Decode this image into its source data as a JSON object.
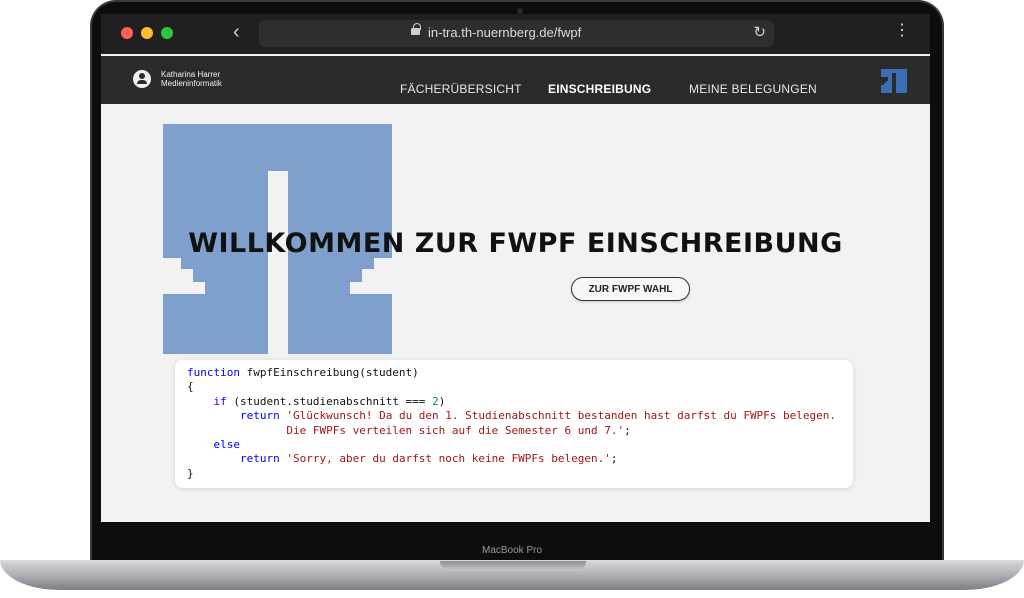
{
  "device": {
    "model_label": "MacBook Pro"
  },
  "browser": {
    "url": "in-tra.th-nuernberg.de/fwpf",
    "back_icon": "‹",
    "forward_icon": "›",
    "reload_icon": "↻",
    "menu_icon": "⋮"
  },
  "header": {
    "user_name": "Katharina Harrer",
    "user_department": "Medieninformatik",
    "nav": [
      {
        "label": "FÄCHERÜBERSICHT"
      },
      {
        "label": "EINSCHREIBUNG"
      },
      {
        "label": "MEINE BELEGUNGEN"
      }
    ],
    "logo_color": "#3a6fb5"
  },
  "main": {
    "title": "WILLKOMMEN ZUR FWPF EINSCHREIBUNG",
    "cta_label": "ZUR FWPF WAHL",
    "logo_color": "#7fa0cc"
  },
  "code": {
    "line1_kw": "function",
    "line1_rest": " fwpfEinschreibung(student)",
    "line2": "{",
    "line3_kw": "if",
    "line3_rest": " (student.studienabschnitt === ",
    "line3_num": "2",
    "line3_end": ")",
    "line4_kw": "return",
    "line4_str": "'Glückwunsch! Da du den 1. Studienabschnitt bestanden hast darfst du FWPFs belegen.",
    "line5_str": "Die FWPFs verteilen sich auf die Semester 6 und 7.'",
    "line5_end": ";",
    "line6_kw": "else",
    "line7_kw": "return",
    "line7_str": "'Sorry, aber du darfst noch keine FWPFs belegen.'",
    "line7_end": ";",
    "line8": "}"
  }
}
